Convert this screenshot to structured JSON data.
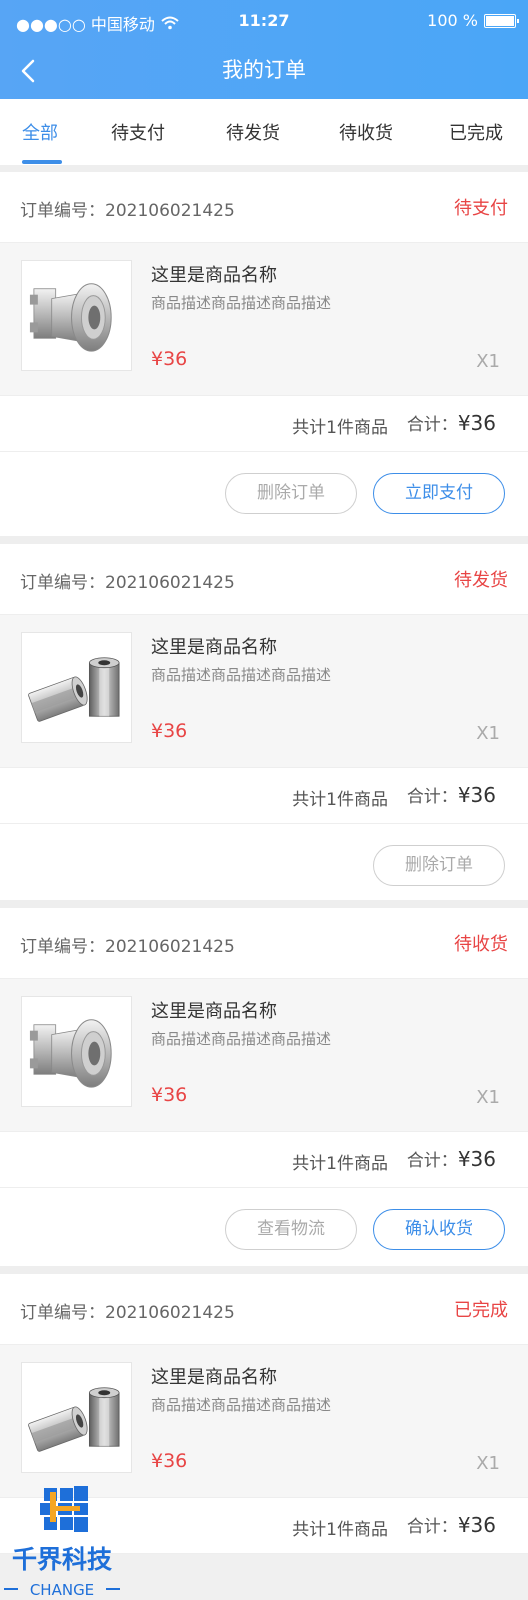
{
  "status_bar": {
    "carrier": "●●●○○ 中国移动",
    "time": "11:27",
    "battery": "100 %"
  },
  "nav": {
    "title": "我的订单"
  },
  "tabs": [
    {
      "label": "全部",
      "active": true
    },
    {
      "label": "待支付",
      "active": false
    },
    {
      "label": "待发货",
      "active": false
    },
    {
      "label": "待收货",
      "active": false
    },
    {
      "label": "已完成",
      "active": false
    }
  ],
  "orders": [
    {
      "order_no": "订单编号：202106021425",
      "status": "待支付",
      "product": {
        "name": "这里是商品名称",
        "desc": "商品描述商品描述商品描述",
        "price": "¥36",
        "qty": "X1",
        "image": "flange-part"
      },
      "summary": {
        "count": "共计1件商品",
        "total_label": "合计：",
        "total": "¥36"
      },
      "actions": [
        "删除订单",
        "立即支付"
      ]
    },
    {
      "order_no": "订单编号：202106021425",
      "status": "待发货",
      "product": {
        "name": "这里是商品名称",
        "desc": "商品描述商品描述商品描述",
        "price": "¥36",
        "qty": "X1",
        "image": "hex-standoff"
      },
      "summary": {
        "count": "共计1件商品",
        "total_label": "合计：",
        "total": "¥36"
      },
      "actions": [
        "删除订单"
      ]
    },
    {
      "order_no": "订单编号：202106021425",
      "status": "待收货",
      "product": {
        "name": "这里是商品名称",
        "desc": "商品描述商品描述商品描述",
        "price": "¥36",
        "qty": "X1",
        "image": "flange-part"
      },
      "summary": {
        "count": "共计1件商品",
        "total_label": "合计：",
        "total": "¥36"
      },
      "actions": [
        "查看物流",
        "确认收货"
      ]
    },
    {
      "order_no": "订单编号：202106021425",
      "status": "已完成",
      "product": {
        "name": "这里是商品名称",
        "desc": "商品描述商品描述商品描述",
        "price": "¥36",
        "qty": "X1",
        "image": "hex-standoff"
      },
      "summary": {
        "count": "共计1件商品",
        "total_label": "合计：",
        "total": "¥36"
      },
      "actions": []
    }
  ],
  "watermark": {
    "name": "千界科技",
    "sub": "CHANGE"
  },
  "colors": {
    "primary": "#3d8ee8",
    "status_red": "#e84545",
    "header_gradient": "#57a5f5"
  }
}
